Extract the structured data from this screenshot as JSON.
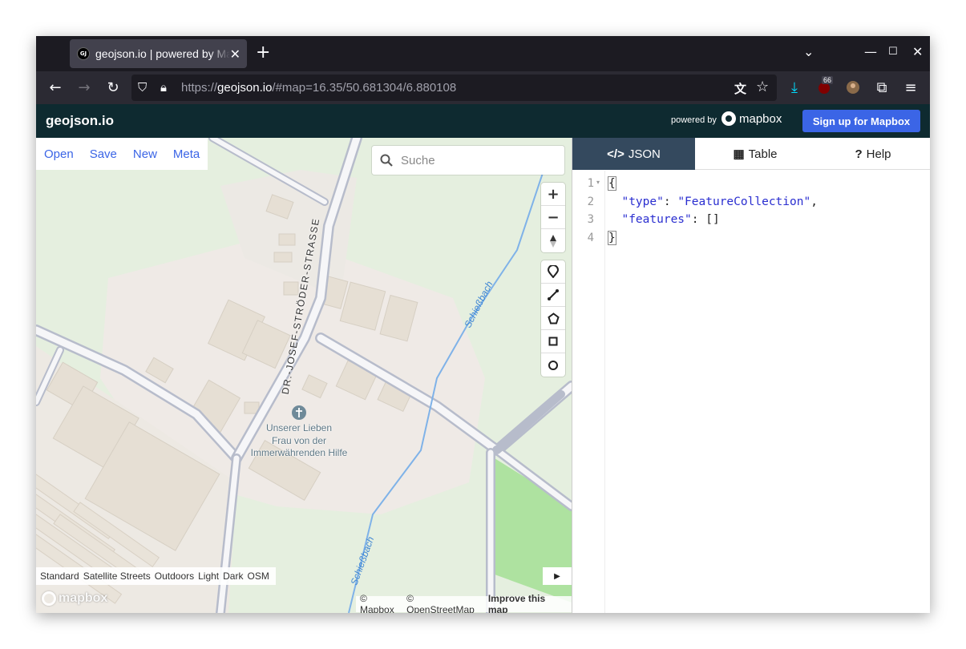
{
  "browser": {
    "tab_title": "geojson.io | powered by Mapbox",
    "favicon_text": "GJ",
    "url_prefix": "https://",
    "url_host": "geojson.io",
    "url_path": "/#map=16.35/50.681304/6.880108",
    "extension_badge": "66"
  },
  "app": {
    "brand": "geojson.io",
    "powered_by": "powered by",
    "mapbox_wordmark": "mapbox",
    "signup_label": "Sign up for Mapbox"
  },
  "filemenu": {
    "items": [
      "Open",
      "Save",
      "New",
      "Meta"
    ]
  },
  "search": {
    "placeholder": "Suche"
  },
  "map": {
    "street_label": "DR.-JOSEF-STRÖDER-STRASSE",
    "stream_label": "Schießbach",
    "poi_line1": "Unserer Lieben",
    "poi_line2": "Frau von der",
    "poi_line3": "Immerwährenden Hilfe",
    "styles": [
      "Standard",
      "Satellite Streets",
      "Outdoors",
      "Light",
      "Dark",
      "OSM"
    ],
    "attribution_mapbox": "© Mapbox",
    "attribution_osm": "© OpenStreetMap",
    "improve_link": "Improve this map",
    "logo_text": "mapbox"
  },
  "panel": {
    "tabs": [
      {
        "icon": "</>",
        "label": "JSON"
      },
      {
        "icon": "▦",
        "label": "Table"
      },
      {
        "icon": "?",
        "label": "Help"
      }
    ],
    "line_numbers": [
      "1",
      "2",
      "3",
      "4"
    ],
    "code": {
      "open_brace": "{",
      "type_key": "\"type\"",
      "type_value": "\"FeatureCollection\"",
      "features_key": "\"features\"",
      "features_value": "[]",
      "close_brace": "}"
    }
  },
  "colors": {
    "header_bg": "#0e2a30",
    "signup_bg": "#3b65e6",
    "active_tab_bg": "#34495e",
    "link_blue": "#3b65e6"
  }
}
